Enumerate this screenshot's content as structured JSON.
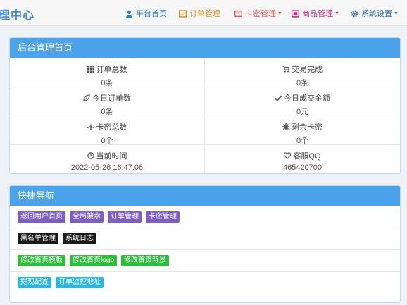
{
  "app": {
    "brand": "理中心"
  },
  "nav": [
    {
      "label": "平台首页",
      "icon": "user-icon",
      "color": "#1f7fc9",
      "dropdown": false
    },
    {
      "label": "订单管理",
      "icon": "list-icon",
      "color": "#d4891c",
      "dropdown": false
    },
    {
      "label": "卡密管理",
      "icon": "card-icon",
      "color": "#e05a5a",
      "dropdown": true
    },
    {
      "label": "商品管理",
      "icon": "shop-icon",
      "color": "#c2297a",
      "dropdown": true
    },
    {
      "label": "系统设置",
      "icon": "gear-icon",
      "color": "#2c6db3",
      "dropdown": true
    }
  ],
  "dashboard": {
    "title": "后台管理首页",
    "stats": [
      {
        "label": "订单总数",
        "value": "0条",
        "icon": "grid-icon"
      },
      {
        "label": "交易完成",
        "value": "0条",
        "icon": "cart-icon"
      },
      {
        "label": "今日订单数",
        "value": "0条",
        "icon": "leaf-icon"
      },
      {
        "label": "今日成交金额",
        "value": "0元",
        "icon": "check-icon"
      },
      {
        "label": "卡密总数",
        "value": "0个",
        "icon": "plane-icon"
      },
      {
        "label": "剩余卡密",
        "value": "0个",
        "icon": "asterisk-icon"
      },
      {
        "label": "当前时间",
        "value": "2022-05-26 16:47:06",
        "icon": "clock-icon"
      },
      {
        "label": "客服QQ",
        "value": "465420700",
        "icon": "heart-icon"
      }
    ]
  },
  "quicknav": {
    "title": "快捷导航",
    "rows": [
      {
        "color": "purple",
        "items": [
          "返回用户首页",
          "全局搜索",
          "订单管理",
          "卡密管理"
        ]
      },
      {
        "color": "black",
        "items": [
          "黑名单管理",
          "系统日志"
        ]
      },
      {
        "color": "green",
        "items": [
          "修改首页模板",
          "修改首页logo",
          "修改首页背景"
        ]
      },
      {
        "color": "cyan",
        "items": [
          "提现配置",
          "订单监控地址"
        ]
      }
    ]
  }
}
